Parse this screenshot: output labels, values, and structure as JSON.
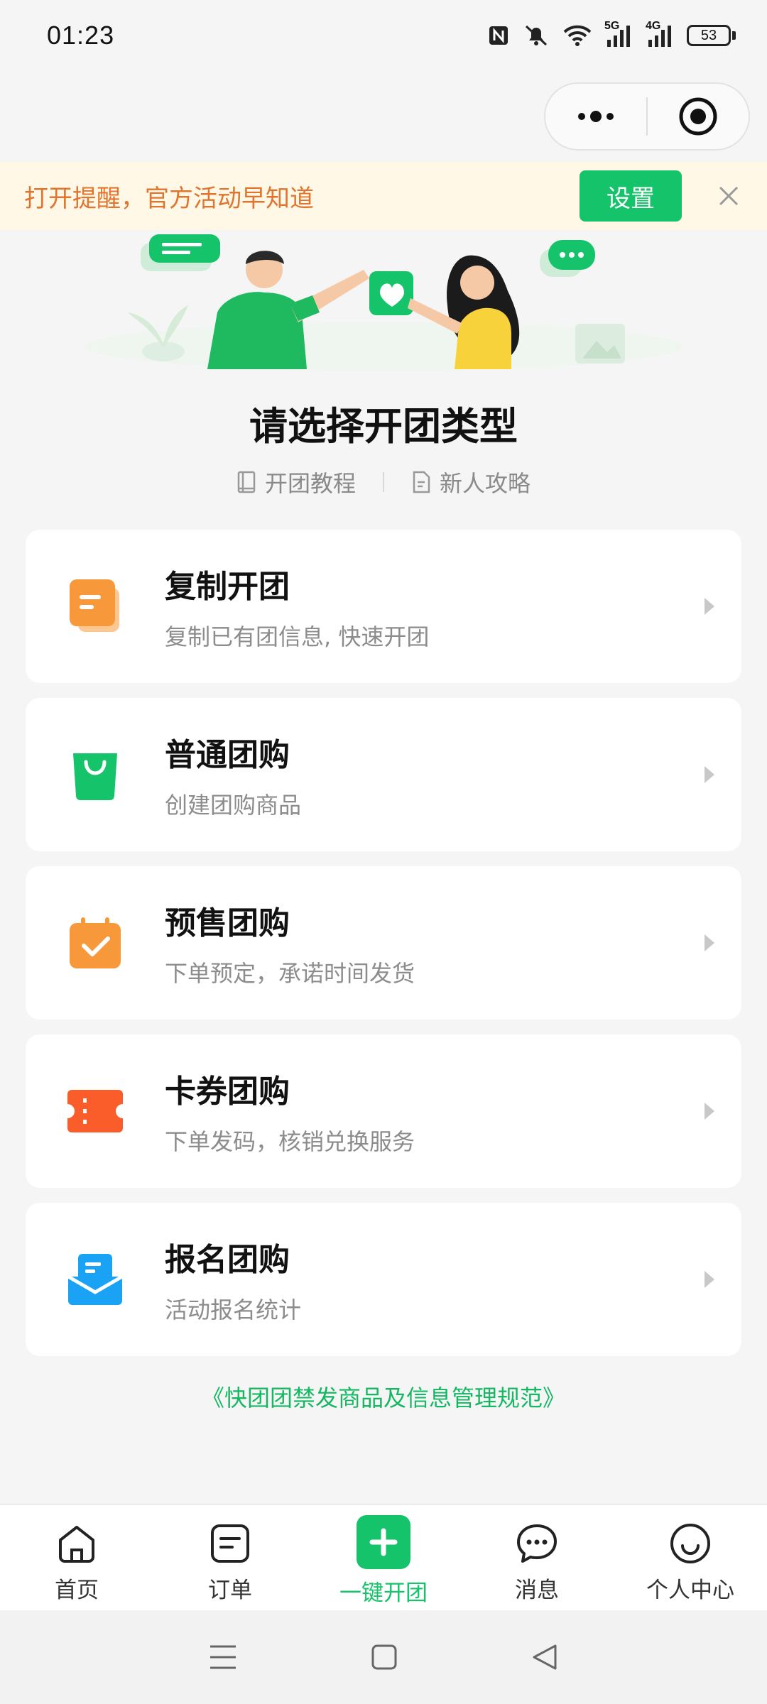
{
  "status_bar": {
    "time": "01:23",
    "battery": "53",
    "signal_5g": "5G",
    "signal_4g": "4G"
  },
  "capsule": {
    "more_icon": "more-dots-icon",
    "close_icon": "target-circle-icon"
  },
  "banner": {
    "text": "打开提醒，官方活动早知道",
    "button": "设置"
  },
  "page": {
    "title": "请选择开团类型",
    "links": [
      {
        "label": "开团教程",
        "icon": "book-icon"
      },
      {
        "label": "新人攻略",
        "icon": "document-icon"
      }
    ]
  },
  "options": [
    {
      "title": "复制开团",
      "desc": "复制已有团信息, 快速开团",
      "icon": "copy-doc-icon",
      "color": "#f7993b"
    },
    {
      "title": "普通团购",
      "desc": "创建团购商品",
      "icon": "shopping-bag-icon",
      "color": "#15c46a"
    },
    {
      "title": "预售团购",
      "desc": "下单预定，承诺时间发货",
      "icon": "calendar-check-icon",
      "color": "#f7993b"
    },
    {
      "title": "卡券团购",
      "desc": "下单发码，核销兑换服务",
      "icon": "ticket-icon",
      "color": "#fb5d2a"
    },
    {
      "title": "报名团购",
      "desc": "活动报名统计",
      "icon": "inbox-form-icon",
      "color": "#1aa3f5"
    }
  ],
  "rules_link": "《快团团禁发商品及信息管理规范》",
  "tabbar": [
    {
      "label": "首页",
      "icon": "home-icon"
    },
    {
      "label": "订单",
      "icon": "order-icon"
    },
    {
      "label": "一键开团",
      "icon": "plus-icon",
      "active": true
    },
    {
      "label": "消息",
      "icon": "chat-icon"
    },
    {
      "label": "个人中心",
      "icon": "smile-icon"
    }
  ],
  "colors": {
    "accent": "#15c46a",
    "banner_text": "#e0752f",
    "banner_bg": "#fff8e6"
  }
}
